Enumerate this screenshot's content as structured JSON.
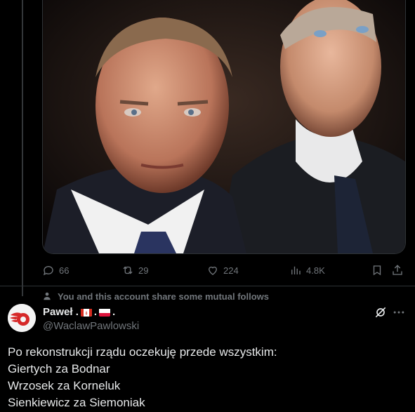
{
  "post": {
    "media_alt": "Photo of two men in dark suits",
    "stats": {
      "replies": "66",
      "reposts": "29",
      "likes": "224",
      "views": "4.8K"
    }
  },
  "social_context": {
    "text": "You and this account share some mutual follows"
  },
  "reply": {
    "display_name": "Paweł .",
    "display_sep": ".",
    "display_end": ".",
    "handle": "@WaclawPawlowski",
    "lines": [
      "Po rekonstrukcji rządu oczekuję przede wszystkim:",
      "Giertych za Bodnar",
      "Wrzosek za Korneluk",
      "Sienkiewicz za Siemoniak"
    ]
  },
  "icons": {
    "reply": "reply-icon",
    "repost": "repost-icon",
    "like": "heart-icon",
    "views": "views-icon",
    "bookmark": "bookmark-icon",
    "share": "share-icon",
    "person": "person-icon",
    "grok": "grok-icon",
    "more": "more-icon"
  },
  "colors": {
    "background": "#000000",
    "text_primary": "#e7e9ea",
    "text_secondary": "#71767b",
    "border": "#2f3336",
    "avatar_logo": "#d62828"
  }
}
